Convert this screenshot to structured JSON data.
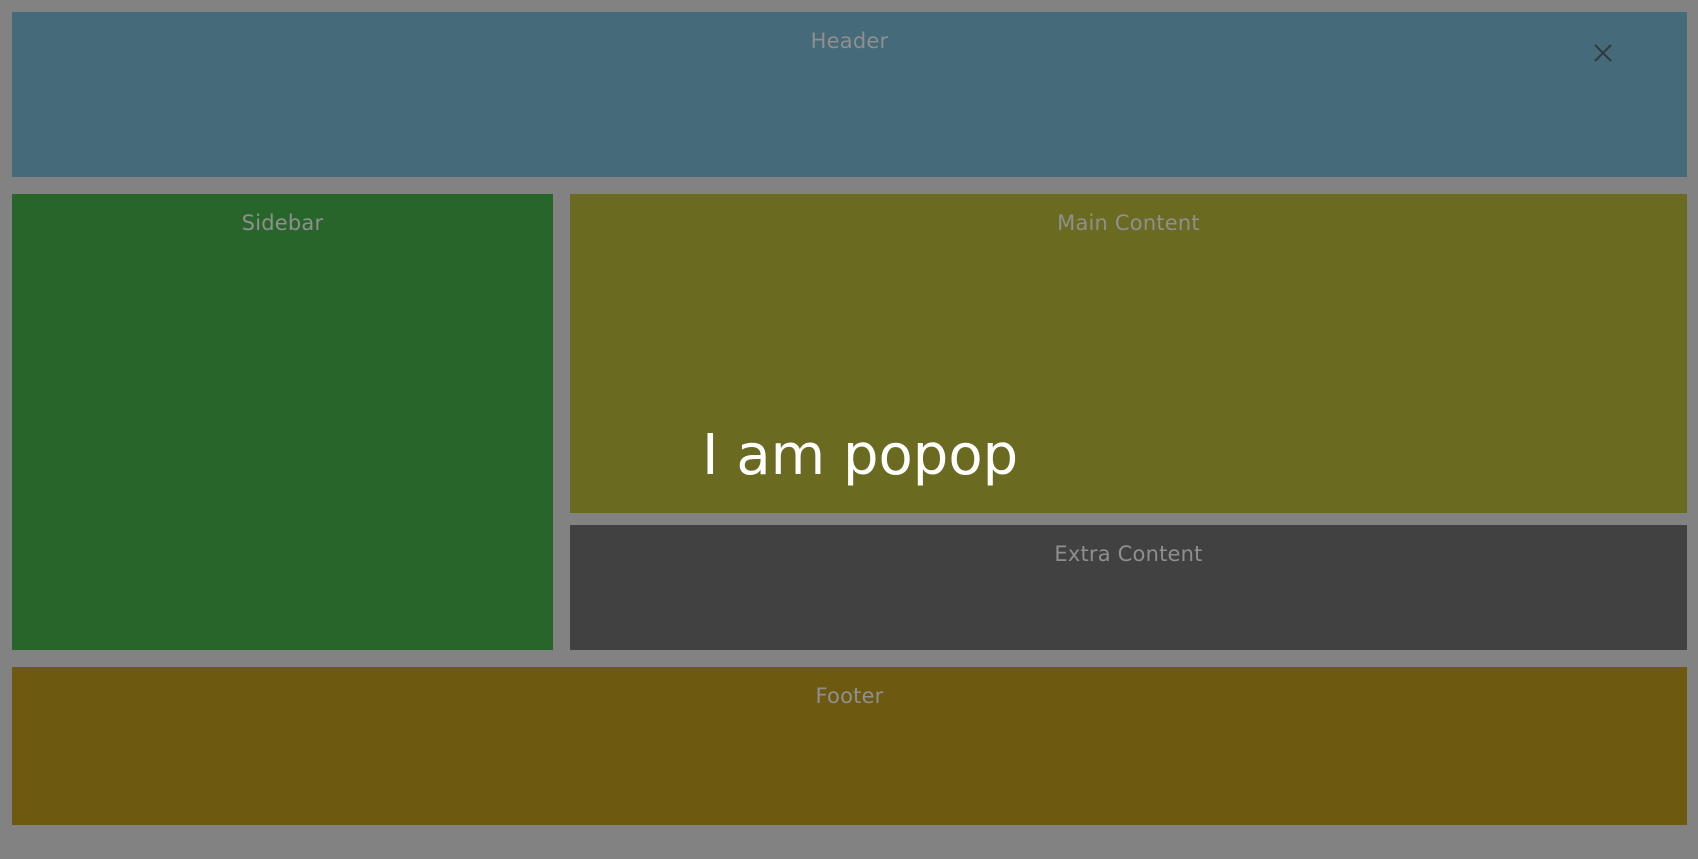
{
  "layout": {
    "header": {
      "label": "Header",
      "color": "#456a79"
    },
    "sidebar": {
      "label": "Sidebar",
      "color": "#28652b"
    },
    "main": {
      "label": "Main Content",
      "color": "#6a6a21"
    },
    "extra": {
      "label": "Extra Content",
      "color": "#414141"
    },
    "footer": {
      "label": "Footer",
      "color": "#6e5911"
    }
  },
  "overlay": {
    "color": "#828282",
    "popup_text": "I am popop",
    "close_icon": "close-icon"
  }
}
